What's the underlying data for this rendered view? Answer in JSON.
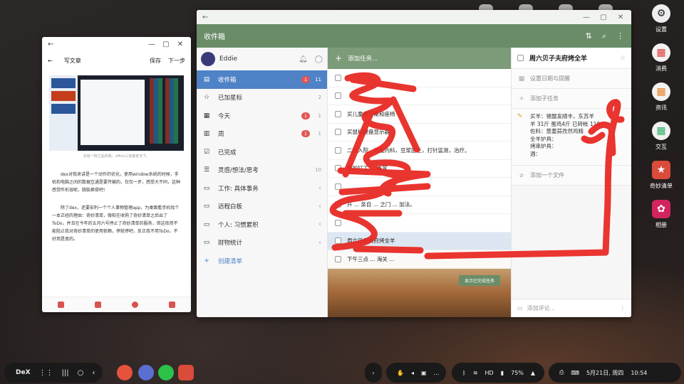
{
  "dock": {
    "items": [
      {
        "label": "设置",
        "icon": "settings-icon"
      },
      {
        "label": "消费",
        "icon": "shopping-icon"
      },
      {
        "label": "资讯",
        "icon": "news-icon"
      },
      {
        "label": "交互",
        "icon": "interaction-icon"
      },
      {
        "label": "奇妙清单",
        "icon": "wunderlist-icon"
      },
      {
        "label": "相册",
        "icon": "gallery-icon"
      }
    ]
  },
  "article_window": {
    "back": "←",
    "minimize": "—",
    "maximize": "▢",
    "close": "✕",
    "title": "写文章",
    "save": "保存",
    "next": "下一步",
    "caption": "没有一统之后的我，office三剑客走天下。",
    "paragraph1": "dex对我来讲是一个动作的优化，使用window系统的时候，手机和电脑之间的数据互通是要传输的，仅仅一步，感受大不同，这种感觉咋形容呢，脱胎换骨吧!",
    "paragraph2": "除了dex，还要安利一个个人事物管理app，为桌面看手机找个一本正经的理由：奇妙清单，微软在收购了奇妙清单之后出了ToDo，并且在今年的五月六号停止了奇妙清单的服务，但这依然不能阻止我对奇妙清单的使用依赖，停就停吧，反正我不用ToDo，不好用是真的。"
  },
  "main_window": {
    "back": "←",
    "minimize": "—",
    "maximize": "▢",
    "close": "✕",
    "appbar_title": "收件箱",
    "user_name": "Eddie",
    "sidebar": [
      {
        "label": "收件箱",
        "icon": "inbox-icon",
        "glyph": "▤",
        "badge": "1",
        "count": "11",
        "active": true
      },
      {
        "label": "已加星标",
        "icon": "star-icon",
        "glyph": "☆",
        "badge": "",
        "count": "2"
      },
      {
        "label": "今天",
        "icon": "calendar-today-icon",
        "glyph": "▦",
        "badge": "1",
        "count": "1"
      },
      {
        "label": "周",
        "icon": "calendar-week-icon",
        "glyph": "▥",
        "badge": "1",
        "count": "1"
      },
      {
        "label": "已完成",
        "icon": "check-box-icon",
        "glyph": "☑",
        "badge": "",
        "count": ""
      },
      {
        "label": "灵感/想法/思考",
        "icon": "list-icon",
        "glyph": "☰",
        "badge": "",
        "count": "10"
      },
      {
        "label": "工作: 具体事务",
        "icon": "folder-icon",
        "glyph": "▭",
        "badge": "",
        "count": "",
        "chevron": "‹"
      },
      {
        "label": "远程白板",
        "icon": "folder-icon",
        "glyph": "▭",
        "badge": "",
        "count": "",
        "chevron": "‹"
      },
      {
        "label": "个人: 习惯累积",
        "icon": "folder-icon",
        "glyph": "▭",
        "badge": "",
        "count": "",
        "chevron": "‹"
      },
      {
        "label": "财物统计",
        "icon": "folder-icon",
        "glyph": "▭",
        "badge": "",
        "count": "",
        "chevron": "‹"
      }
    ],
    "create_list": "创建清单",
    "add_task": "添加任务...",
    "tasks": [
      {
        "title": "",
        "selected": false
      },
      {
        "title": "",
        "selected": false
      },
      {
        "title": "买儿童学习桌和座椅",
        "selected": false
      },
      {
        "title": "买鼠标键盘显示器",
        "selected": false
      },
      {
        "title": "二次入院，呼吸内科，豆浆医生，打针监测，治疗。",
        "selected": false
      },
      {
        "title": "参加打工 ... 事宜",
        "selected": false
      },
      {
        "title": "",
        "selected": false
      },
      {
        "title": "开 ... 亲自 ... 之门 ... 加法。",
        "selected": false
      },
      {
        "title": "",
        "selected": false
      },
      {
        "title": "周六贝子夫府烤全羊",
        "selected": true
      },
      {
        "title": "下午三点 ... 海关 ...",
        "selected": false
      }
    ],
    "show_completed": "显示已完成任务",
    "detail": {
      "title": "周六贝子夫府烤全羊",
      "due": "设置日期与提醒",
      "subtask": "添加子任务",
      "note_lines": [
        "买羊：锡盟发顺丰，东苏羊",
        "羊 31斤  蛋鸡4斤  已转帐 119",
        "佐料：葱姜蒜孜然鸡精",
        "全羊炉具：",
        "烤串炉具：",
        "酒："
      ],
      "file": "添加一个文件",
      "comment": "添加评论..."
    }
  },
  "taskbar": {
    "dex": "DeX",
    "battery": "75%",
    "date": "5月21日, 周四",
    "time": "10:54"
  },
  "colors": {
    "appbar": "#6a8d68",
    "sidebar_active": "#4f82c6",
    "scribble": "#e8241e"
  }
}
